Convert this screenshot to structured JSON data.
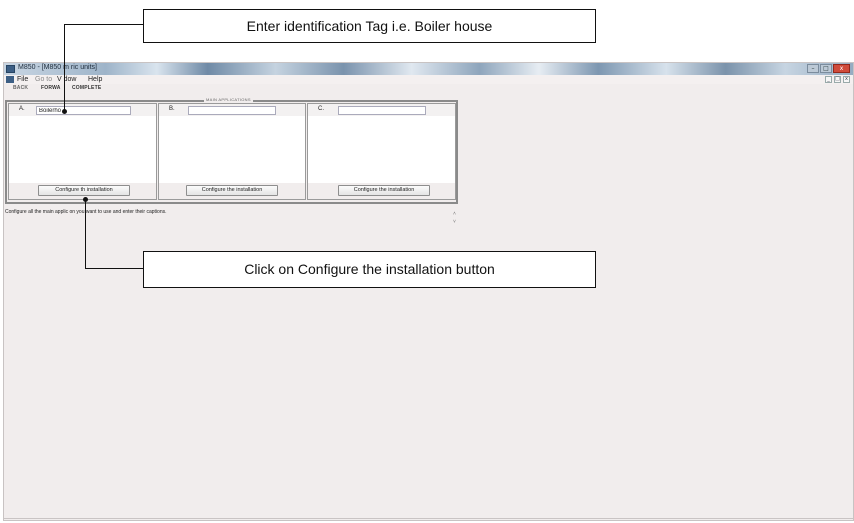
{
  "window": {
    "title": "M850 - [M850 m   ric units]",
    "controls": [
      "–",
      "□",
      "x"
    ]
  },
  "menubar": {
    "items": [
      "File",
      "Go to",
      "V    dow",
      "Help"
    ],
    "mdi_controls": [
      "_",
      "□",
      "x"
    ]
  },
  "toolbar": {
    "items": [
      "BACK",
      "FORWA",
      "COMPLETE"
    ]
  },
  "main_applications": {
    "title": "MAIN APPLICATIONS",
    "panels": [
      {
        "letter": "A.",
        "input_value": "Boilerho",
        "button_label": "Configure th   installation"
      },
      {
        "letter": "B.",
        "input_value": "",
        "button_label": "Configure the installation"
      },
      {
        "letter": "C.",
        "input_value": "",
        "button_label": "Configure the installation"
      }
    ]
  },
  "status_text": "Configure all the main applic    on you want to use and enter their captions.",
  "scroll_marks": [
    "˄",
    "˅"
  ],
  "callouts": {
    "top": "Enter identification Tag i.e. Boiler house",
    "bottom": "Click on Configure the installation button"
  },
  "colors": {
    "app_background": "#f1eded",
    "frame_border": "#8a8a8a",
    "close_button": "#d04a3a",
    "callout_border": "#111111"
  }
}
